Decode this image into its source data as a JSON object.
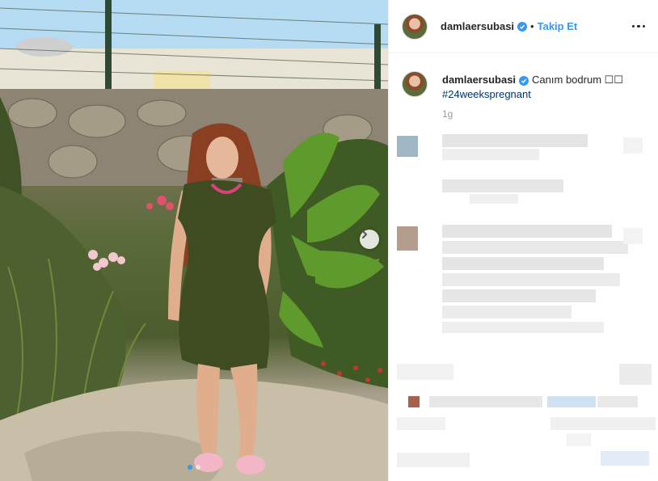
{
  "post": {
    "username": "damlaersubasi",
    "follow_label": "Takip Et",
    "bullet": "•",
    "caption_text": "Canım bodrum ☐☐",
    "hashtag": "#24weekspregnant",
    "time_ago": "1g"
  },
  "carousel": {
    "slide_count": 2,
    "active_slide": 1
  },
  "colors": {
    "accent": "#3897f0",
    "hashtag": "#003569",
    "text": "#262626"
  },
  "icons": {
    "verified": "verified-badge-icon",
    "more": "more-options-icon",
    "next": "chevron-right-icon"
  }
}
